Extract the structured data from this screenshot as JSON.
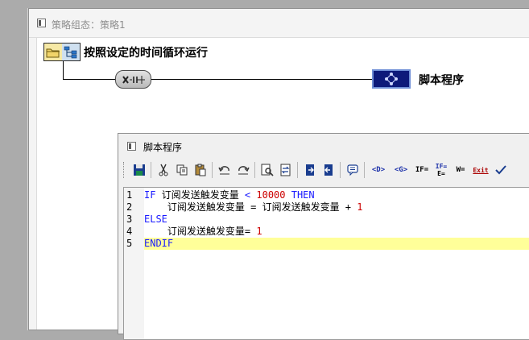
{
  "outer_window": {
    "title": "策略组态：策略1"
  },
  "flow": {
    "start_label": "按照设定的时间循环运行",
    "script_label": "脚本程序"
  },
  "script_window": {
    "title": "脚本程序"
  },
  "toolbar": {
    "buttons": [
      {
        "name": "save",
        "icon": "floppy-icon"
      },
      {
        "name": "cut",
        "icon": "scissors-icon"
      },
      {
        "name": "copy",
        "icon": "copy-icon"
      },
      {
        "name": "paste",
        "icon": "paste-icon"
      },
      {
        "name": "undo",
        "icon": "undo-icon"
      },
      {
        "name": "redo",
        "icon": "redo-icon"
      },
      {
        "name": "find",
        "icon": "magnifier-icon"
      },
      {
        "name": "replace",
        "icon": "replace-icon"
      },
      {
        "name": "indent",
        "icon": "indent-icon"
      },
      {
        "name": "outdent",
        "icon": "outdent-icon"
      },
      {
        "name": "comment",
        "icon": "comment-icon"
      }
    ],
    "text_buttons": {
      "data_obj": "<D>",
      "global": "<G>",
      "if_then": "IF=",
      "if_else_top": "IF=",
      "if_else_bot": "E=",
      "while": "W=",
      "exit": "Exit"
    }
  },
  "code": {
    "lines": [
      {
        "no": "1",
        "parts": [
          [
            "kw",
            "IF "
          ],
          [
            "id",
            "订阅发送触发变量 "
          ],
          [
            "kw",
            "< "
          ],
          [
            "num",
            "10000"
          ],
          [
            "kw",
            " THEN"
          ]
        ]
      },
      {
        "no": "2",
        "parts": [
          [
            "id",
            "    订阅发送触发变量 = 订阅发送触发变量 + "
          ],
          [
            "num",
            "1"
          ]
        ]
      },
      {
        "no": "3",
        "parts": [
          [
            "kw",
            "ELSE"
          ]
        ]
      },
      {
        "no": "4",
        "parts": [
          [
            "id",
            "    订阅发送触发变量= "
          ],
          [
            "num",
            "1"
          ]
        ]
      },
      {
        "no": "5",
        "parts": [
          [
            "kw",
            "ENDIF"
          ]
        ]
      }
    ],
    "highlight_line": 5
  },
  "colors": {
    "keyword": "#1a1aff",
    "number": "#cc0000",
    "current_line": "#ffff99",
    "script_node": "#0d1a7a"
  }
}
